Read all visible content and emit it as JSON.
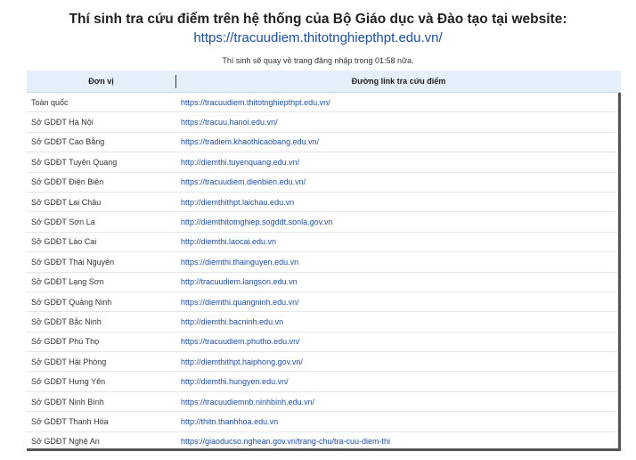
{
  "header": {
    "title": "Thí sinh tra cứu điểm trên hệ thống của Bộ Giáo dục và Đào tạo tại website:",
    "link": "https://tracuudiem.thitotnghiepthpt.edu.vn/",
    "countdown": "Thí sinh sẽ quay về trang đăng nhập trong 01:58 nữa."
  },
  "table": {
    "columns": [
      "Đơn vị",
      "Đường link tra cứu điểm"
    ],
    "rows": [
      {
        "unit": "Toàn quốc",
        "link": "https://tracuudiem.thitotnghiepthpt.edu.vn/"
      },
      {
        "unit": "Sở GDĐT Hà Nội",
        "link": "https://tracuu.hanoi.edu.vn/"
      },
      {
        "unit": "Sở GDĐT Cao Bằng",
        "link": "https://tradiem.khaothicaobang.edu.vn/"
      },
      {
        "unit": "Sở GDĐT Tuyên Quang",
        "link": "http://diemthi.tuyenquang.edu.vn/"
      },
      {
        "unit": "Sở GDĐT Điện Biên",
        "link": "https://tracuudiem.dienbien.edu.vn/"
      },
      {
        "unit": "Sở GDĐT Lai Châu",
        "link": "http://diemthithpt.laichau.edu.vn"
      },
      {
        "unit": "Sở GDĐT Sơn La",
        "link": "http://diemthitotnghiep.sogddt.sonla.gov.vn"
      },
      {
        "unit": "Sở GDĐT Lào Cai",
        "link": "http://diemthi.laocai.edu.vn"
      },
      {
        "unit": "Sở GDĐT Thái Nguyên",
        "link": "https://diemthi.thainguyen.edu.vn"
      },
      {
        "unit": "Sở GDĐT Lạng Sơn",
        "link": "http://tracuudiem.langson.edu.vn"
      },
      {
        "unit": "Sở GDĐT Quảng Ninh",
        "link": "https://diemthi.quangninh.edu.vn/"
      },
      {
        "unit": "Sở GDĐT Bắc Ninh",
        "link": "http://diemthi.bacninh.edu.vn"
      },
      {
        "unit": "Sở GDĐT Phú Thọ",
        "link": "https://tracuudiem.phutho.edu.vn/"
      },
      {
        "unit": "Sở GDĐT Hải Phòng",
        "link": "http://diemthithpt.haiphong.gov.vn/"
      },
      {
        "unit": "Sở GDĐT Hưng Yên",
        "link": "http://diemthi.hungyen.edu.vn/"
      },
      {
        "unit": "Sở GDĐT Ninh Bình",
        "link": "https://tracuudiemnb.ninhbinh.edu.vn/"
      },
      {
        "unit": "Sở GDĐT Thanh Hóa",
        "link": "http://thitn.thanhhoa.edu.vn"
      },
      {
        "unit": "Sở GDĐT Nghệ An",
        "link": "https://giaoducso.nghean.gov.vn/trang-chu/tra-cuu-diem-thi"
      }
    ]
  }
}
